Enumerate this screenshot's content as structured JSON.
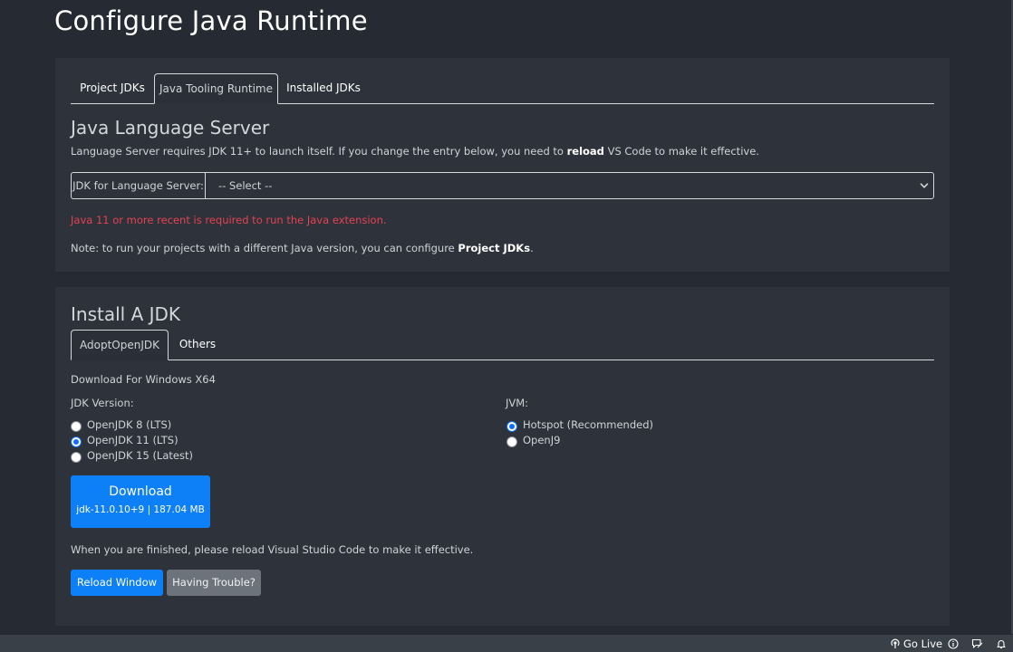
{
  "page": {
    "title": "Configure Java Runtime"
  },
  "runtime_panel": {
    "tabs": [
      {
        "label": "Project JDKs",
        "active": false
      },
      {
        "label": "Java Tooling Runtime",
        "active": true
      },
      {
        "label": "Installed JDKs",
        "active": false
      }
    ],
    "heading": "Java Language Server",
    "description": {
      "before": "Language Server requires JDK 11+ to launch itself. If you change the entry below, you need to ",
      "bold": "reload",
      "after": " VS Code to make it effective."
    },
    "jdk_select": {
      "label": "JDK for Language Server:",
      "value": "-- Select --"
    },
    "error_message": "Java 11 or more recent is required to run the Java extension.",
    "note": {
      "before": "Note: to run your projects with a different Java version, you can configure ",
      "link": "Project JDKs",
      "after": "."
    }
  },
  "install_panel": {
    "heading": "Install A JDK",
    "tabs": [
      {
        "label": "AdoptOpenJDK",
        "active": true
      },
      {
        "label": "Others",
        "active": false
      }
    ],
    "download_for": "Download For Windows X64",
    "jdk_version": {
      "label": "JDK Version:",
      "options": [
        {
          "label": "OpenJDK 8 (LTS)",
          "checked": false
        },
        {
          "label": "OpenJDK 11 (LTS)",
          "checked": true
        },
        {
          "label": "OpenJDK 15 (Latest)",
          "checked": false
        }
      ]
    },
    "jvm": {
      "label": "JVM:",
      "options": [
        {
          "label": "Hotspot (Recommended)",
          "checked": true
        },
        {
          "label": "OpenJ9",
          "checked": false
        }
      ]
    },
    "download_button": {
      "label": "Download",
      "detail": "jdk-11.0.10+9 | 187.04 MB"
    },
    "finish_note": "When you are finished, please reload Visual Studio Code to make it effective.",
    "reload_button": "Reload Window",
    "trouble_button": "Having Trouble?"
  },
  "statusbar": {
    "go_live": "Go Live"
  },
  "colors": {
    "background": "#262b33",
    "panel": "#2e333b",
    "accent": "#0d7ff7",
    "error": "#e5414f",
    "secondary_button": "#6c737b",
    "statusbar": "#3a4048"
  }
}
